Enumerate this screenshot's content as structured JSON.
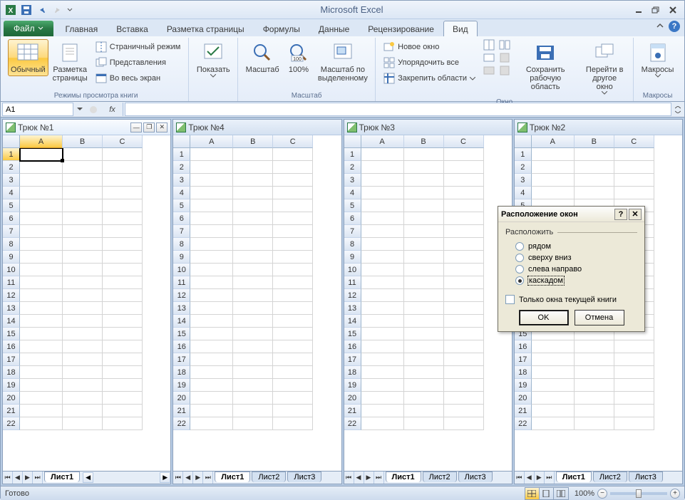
{
  "app": {
    "title": "Microsoft Excel"
  },
  "tabs": {
    "file": "Файл",
    "list": [
      "Главная",
      "Вставка",
      "Разметка страницы",
      "Формулы",
      "Данные",
      "Рецензирование",
      "Вид"
    ],
    "active_index": 6
  },
  "ribbon": {
    "group_view": {
      "normal": "Обычный",
      "page_layout": "Разметка\nстраницы",
      "page_break": "Страничный режим",
      "custom_views": "Представления",
      "full_screen": "Во весь экран",
      "label": "Режимы просмотра книги"
    },
    "group_show": {
      "show": "Показать",
      "label": ""
    },
    "group_zoom": {
      "zoom": "Масштаб",
      "hundred": "100%",
      "selection": "Масштаб по\nвыделенному",
      "label": "Масштаб"
    },
    "group_window": {
      "new_window": "Новое окно",
      "arrange": "Упорядочить все",
      "freeze": "Закрепить области",
      "save_ws": "Сохранить\nрабочую область",
      "switch": "Перейти в\nдругое окно",
      "label": "Окно"
    },
    "group_macros": {
      "macros": "Макросы",
      "label": "Макросы"
    }
  },
  "namebox": "A1",
  "fx_label": "fx",
  "workbooks": [
    {
      "title": "Трюк №1",
      "active": true,
      "sheets": [
        "Лист1"
      ]
    },
    {
      "title": "Трюк №4",
      "active": false,
      "sheets": [
        "Лист1",
        "Лист2",
        "Лист3"
      ]
    },
    {
      "title": "Трюк №3",
      "active": false,
      "sheets": [
        "Лист1",
        "Лист2",
        "Лист3"
      ]
    },
    {
      "title": "Трюк №2",
      "active": false,
      "sheets": [
        "Лист1",
        "Лист2",
        "Лист3"
      ]
    }
  ],
  "columns": [
    "A",
    "B",
    "C"
  ],
  "row_count": 22,
  "dialog": {
    "title": "Расположение окон",
    "group": "Расположить",
    "options": [
      "рядом",
      "сверху вниз",
      "слева направо",
      "каскадом"
    ],
    "selected_index": 3,
    "checkbox": "Только окна текущей книги",
    "ok": "OK",
    "cancel": "Отмена"
  },
  "status": {
    "ready": "Готово",
    "zoom": "100%"
  }
}
